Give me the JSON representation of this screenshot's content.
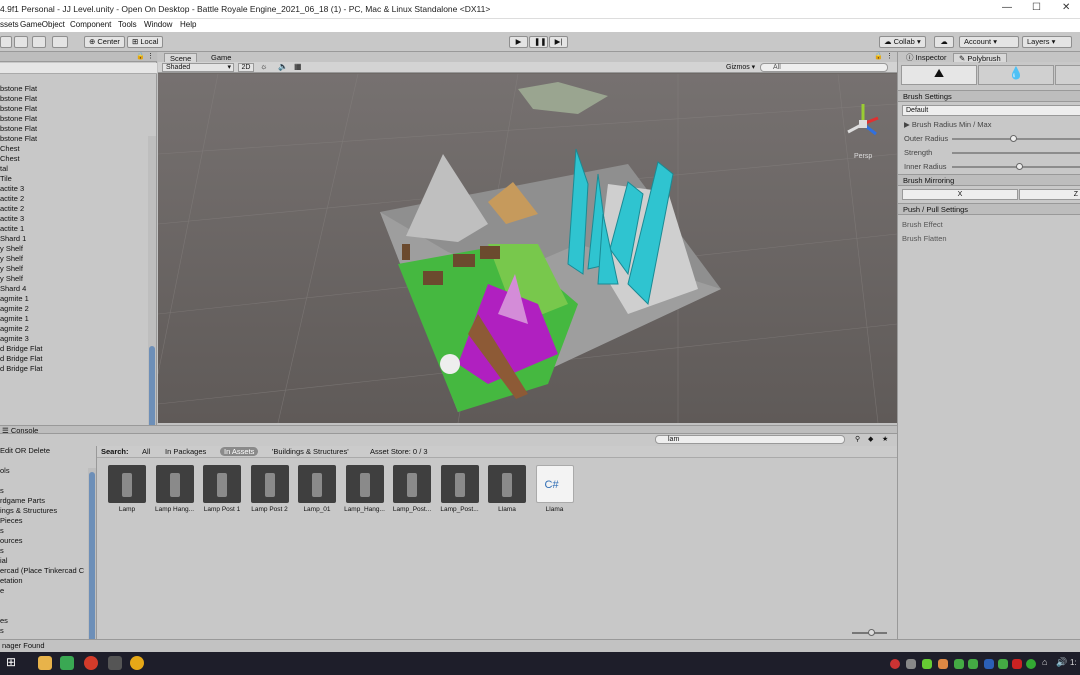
{
  "title_bar": {
    "title": "4.9f1 Personal - JJ Level.unity - Open On Desktop - Battle Royale Engine_2021_06_18 (1) - PC, Mac & Linux Standalone <DX11>"
  },
  "menu": [
    "ssets",
    "GameObject",
    "Component",
    "Tools",
    "Window",
    "Help"
  ],
  "toolbar": {
    "center_label": "Center",
    "local_label": "Local",
    "collab_label": "Collab",
    "account_label": "Account",
    "layers_label": "Layers"
  },
  "hierarchy": {
    "items": [
      "bstone Flat",
      "bstone Flat",
      "bstone Flat",
      "bstone Flat",
      "bstone Flat",
      "bstone Flat",
      "Chest",
      "Chest",
      "tal",
      " Tile",
      "actite 3",
      "actite 2",
      "actite 2",
      "actite 3",
      "actite 1",
      " Shard 1",
      "y Shelf",
      "y Shelf",
      "y Shelf",
      "y Shelf",
      " Shard 4",
      "agmite 1",
      "agmite 2",
      "agmite 1",
      "agmite 2",
      "agmite 3",
      "d Bridge Flat",
      "d Bridge Flat",
      "d Bridge Flat"
    ]
  },
  "scene": {
    "tabs": [
      "Scene",
      "Game"
    ],
    "shading_mode": "Shaded",
    "mode_2d": "2D",
    "gizmos_label": "Gizmos",
    "search_placeholder": "All",
    "persp_label": "Persp"
  },
  "console": {
    "label": "Console"
  },
  "project": {
    "search_value": "lam",
    "tree": [
      " Edit OR Delete",
      "",
      "ols",
      "",
      "s",
      "rdgame Parts",
      "ings & Structures",
      " Pieces",
      "s",
      "ources",
      "s",
      "ial",
      "ercad (Place Tinkercad C",
      "etation",
      "e",
      "",
      "",
      "es",
      "s"
    ],
    "search_label": "Search:",
    "filters": [
      "All",
      "In Packages",
      "In Assets",
      "'Buildings & Structures'",
      "Asset Store: 0 / 3"
    ],
    "assets": [
      "Lamp",
      "Lamp Hang...",
      "Lamp Post 1",
      "Lamp Post 2",
      "Lamp_01",
      "Lamp_Hang...",
      "Lamp_Post...",
      "Lamp_Post...",
      "Llama",
      "Llama"
    ],
    "script_label": "C#"
  },
  "status": {
    "text": "nager Found"
  },
  "inspector": {
    "tabs": [
      "Inspector",
      "Polybrush"
    ],
    "brush_settings": "Brush Settings",
    "preset": "Default",
    "radius_label": "Brush Radius Min / Max",
    "outer_radius": "Outer Radius",
    "strength": "Strength",
    "inner_radius": "Inner Radius",
    "mirroring": "Brush Mirroring",
    "mirror_axis": "X",
    "mirror_axis2": "Z",
    "push_pull": "Push / Pull Settings",
    "brush_effect": "Brush Effect",
    "brush_flatten": "Brush Flatten"
  },
  "taskbar": {
    "clock": "1:"
  }
}
